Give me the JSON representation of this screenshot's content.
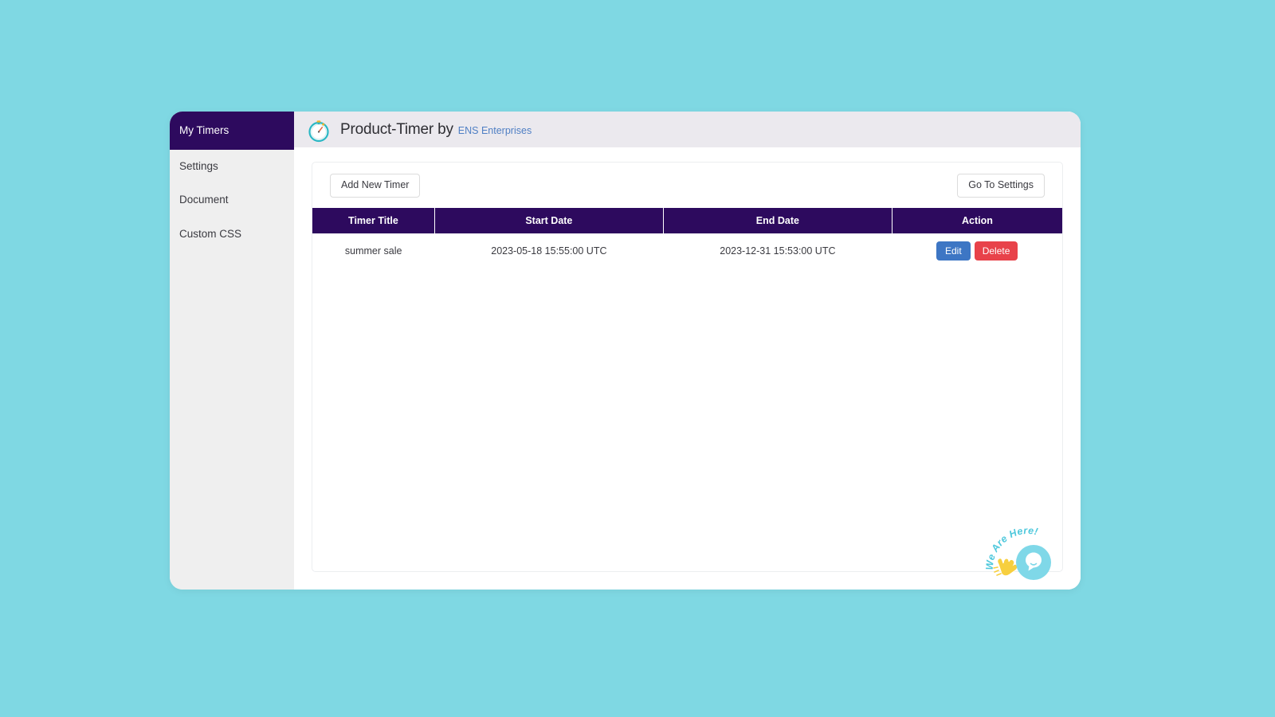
{
  "page": {
    "background_color": "#7fd8e3",
    "card_background": "#ffffff"
  },
  "sidebar": {
    "background_color": "#efefef",
    "active_color": "#2d0a5e",
    "items": [
      {
        "label": "My Timers",
        "name": "sidebar-item-my-timers",
        "active": true
      },
      {
        "label": "Settings",
        "name": "sidebar-item-settings",
        "active": false
      },
      {
        "label": "Document",
        "name": "sidebar-item-document",
        "active": false
      },
      {
        "label": "Custom CSS",
        "name": "sidebar-item-custom-css",
        "active": false
      }
    ]
  },
  "header": {
    "background_color": "#ebe9ee",
    "logo_icon": "stopwatch-icon",
    "title": "Product-Timer by",
    "brand": "ENS Enterprises",
    "brand_color": "#4f7fc4"
  },
  "toolbar": {
    "add_timer_label": "Add New Timer",
    "go_to_settings_label": "Go To Settings"
  },
  "table": {
    "header_background": "#2d0a5e",
    "columns": [
      "Timer Title",
      "Start Date",
      "End Date",
      "Action"
    ],
    "rows": [
      {
        "title": "summer sale",
        "start_date": "2023-05-18 15:55:00 UTC",
        "end_date": "2023-12-31 15:53:00 UTC",
        "edit_label": "Edit",
        "delete_label": "Delete"
      }
    ],
    "edit_color": "#3d76c4",
    "delete_color": "#e8424a"
  },
  "chat_widget": {
    "icon": "chat-bubble-icon",
    "caption": "We Are Here!",
    "wave_icon": "waving-hand-icon",
    "accent_color": "#7fd8e8"
  }
}
